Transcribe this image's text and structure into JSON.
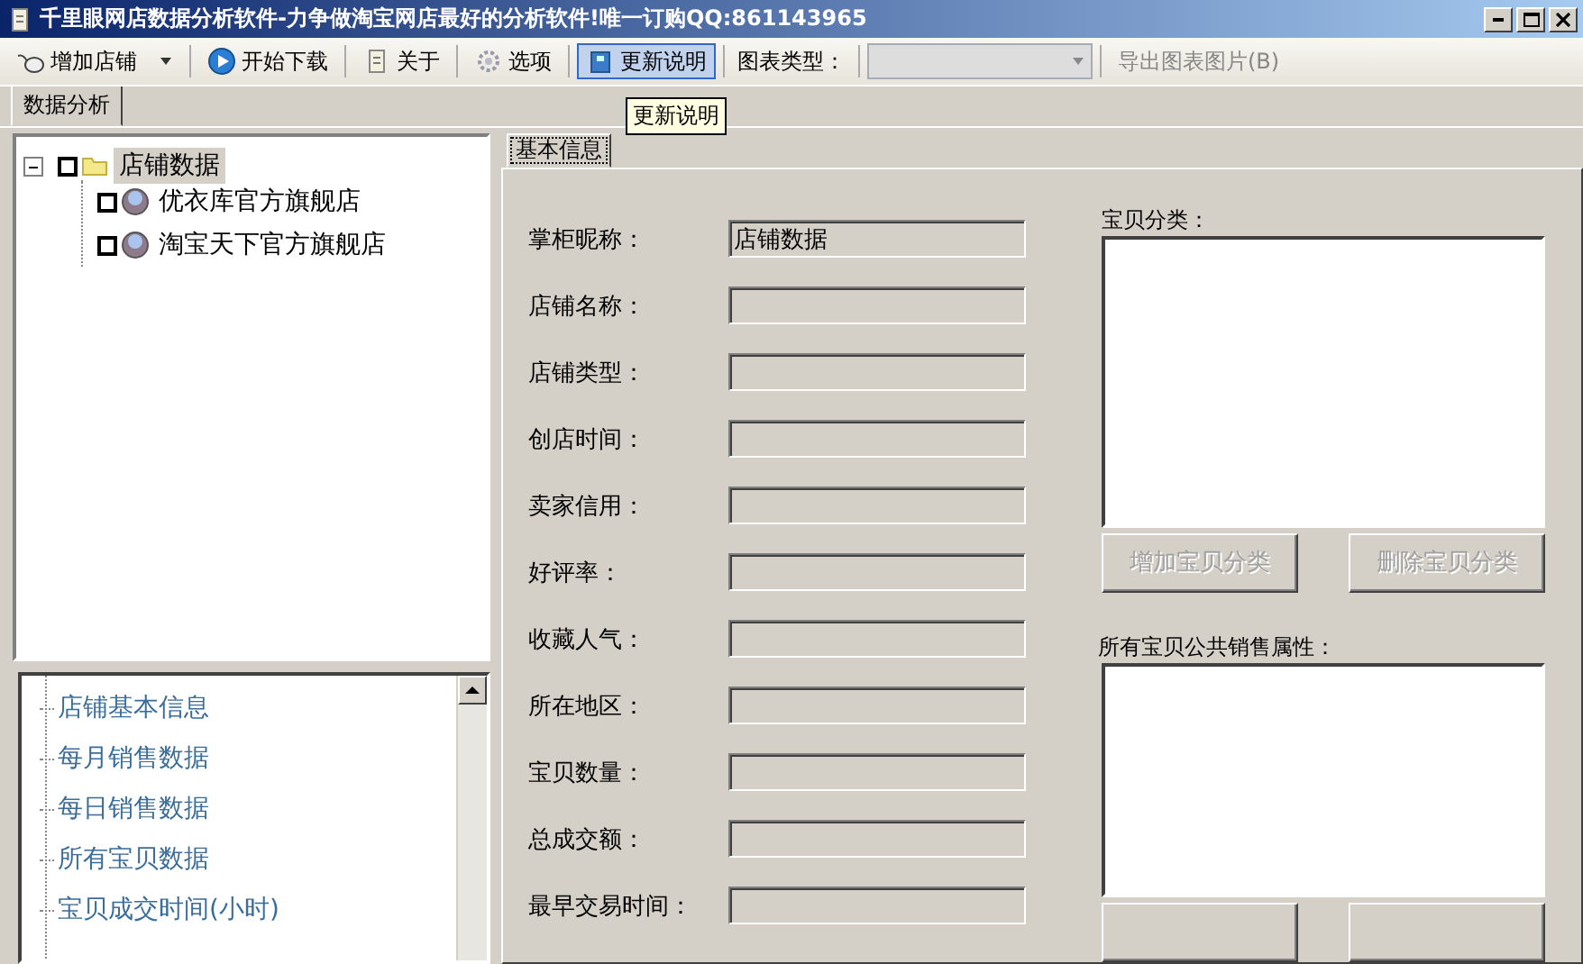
{
  "window": {
    "title": "千里眼网店数据分析软件-力争做淘宝网店最好的分析软件!唯一订购QQ:861143965"
  },
  "toolbar": [
    {
      "kind": "split-button",
      "label": "增加店铺",
      "pressed": false
    },
    {
      "kind": "button",
      "label": "开始下载",
      "pressed": false
    },
    {
      "kind": "button",
      "label": "关于",
      "pressed": false
    },
    {
      "kind": "button",
      "label": "选项",
      "pressed": false
    },
    {
      "kind": "button",
      "label": "更新说明",
      "pressed": true
    },
    {
      "kind": "label",
      "label": "图表类型："
    },
    {
      "kind": "combo",
      "disabled": true
    },
    {
      "kind": "button",
      "label": "导出图表图片(B)",
      "disabled": true,
      "pressed": false
    }
  ],
  "tooltip": "更新说明",
  "tabs": [
    {
      "label": "数据分析",
      "selected": true
    }
  ],
  "tree": [
    {
      "label": "店铺数据",
      "expanded": true,
      "selected": true,
      "checked": false,
      "children": [
        {
          "label": "优衣库官方旗舰店",
          "selected": false,
          "checked": false
        },
        {
          "label": "淘宝天下官方旗舰店",
          "selected": false,
          "checked": false
        }
      ]
    }
  ],
  "nav_list": [
    {
      "label": "店铺基本信息"
    },
    {
      "label": "每月销售数据"
    },
    {
      "label": "每日销售数据"
    },
    {
      "label": "所有宝贝数据"
    },
    {
      "label": "宝贝成交时间(小时)"
    }
  ],
  "info_tabs": [
    {
      "label": "基本信息",
      "selected": true
    }
  ],
  "fields": [
    {
      "label": "掌柜昵称：",
      "value": "店铺数据",
      "disabled": true
    },
    {
      "label": "店铺名称：",
      "disabled": true
    },
    {
      "label": "店铺类型：",
      "disabled": true
    },
    {
      "label": "创店时间：",
      "disabled": true
    },
    {
      "label": "卖家信用：",
      "disabled": true
    },
    {
      "label": "好评率：",
      "disabled": true
    },
    {
      "label": "收藏人气：",
      "disabled": true
    },
    {
      "label": "所在地区：",
      "disabled": true
    },
    {
      "label": "宝贝数量：",
      "disabled": true
    },
    {
      "label": "总成交额：",
      "disabled": true
    },
    {
      "label": "最早交易时间：",
      "disabled": true
    }
  ],
  "category_box": {
    "label": "宝贝分类：",
    "buttons": [
      {
        "label": "增加宝贝分类",
        "disabled": true
      },
      {
        "label": "删除宝贝分类",
        "disabled": true
      }
    ]
  },
  "attribute_box": {
    "label": "所有宝贝公共销售属性："
  }
}
